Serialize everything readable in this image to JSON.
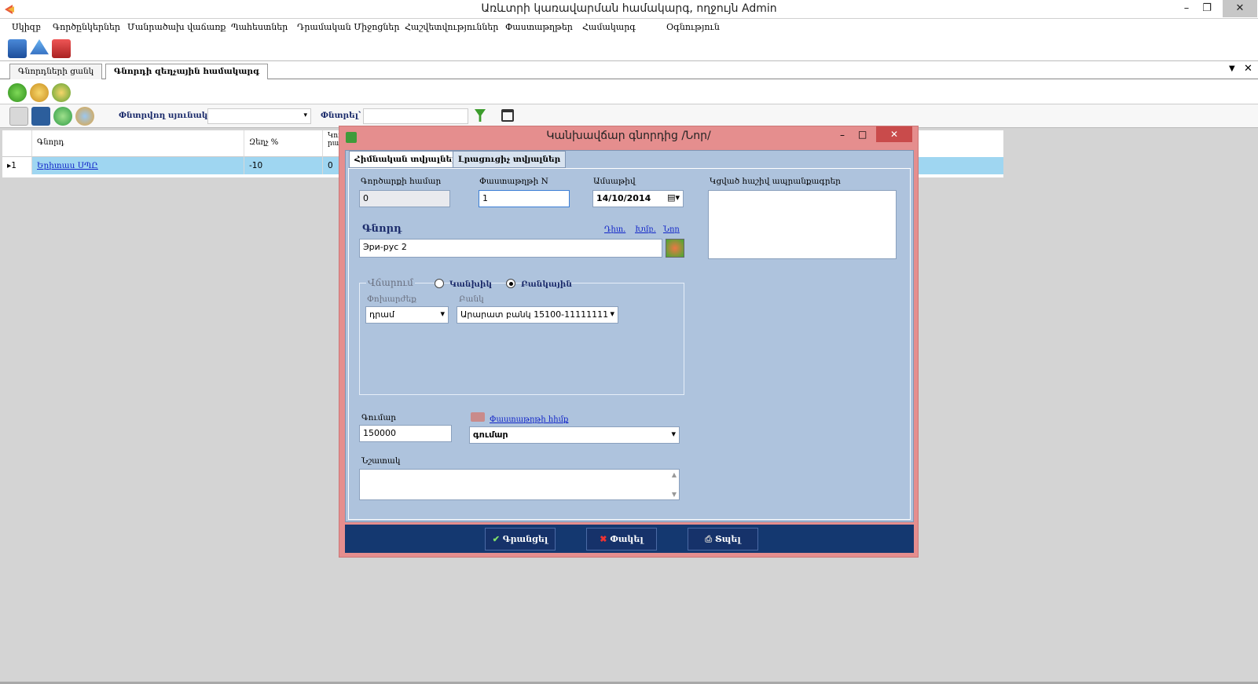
{
  "window": {
    "title": "Առևտրի կառավարման համակարգ, ողջույն Admin",
    "min": "–",
    "restore": "❐",
    "close": "✕"
  },
  "menu": [
    "Սկիզբ",
    "Գործընկերներ",
    "Մանրածախ վաճառք",
    "Պահեստներ",
    "Դրամական Միջոցներ",
    "Հաշվետվություններ",
    "Փաստաթղթեր",
    "Համակարգ",
    "Օգնություն"
  ],
  "tabs": [
    "Գնորդների ցանկ",
    "Գնորդի զեղչային համակարգ"
  ],
  "toolbar": {
    "search_column_label": "Փնտրվող սյունակ՝",
    "search_label": "Փնտրել՝"
  },
  "grid": {
    "headers": [
      "Գնորդ",
      "Զեղչ %",
      "Կու րա"
    ],
    "row": {
      "marker": "▸1",
      "buyer": "Երիտաս ՍՊԸ",
      "discount": "-10",
      "third": "0"
    }
  },
  "dialog": {
    "title": "Կանխավճար գնորդից /Նոր/",
    "tabs": [
      "Հիմնական տվյալներ",
      "Լրացուցիչ տվյալներ"
    ],
    "op_number_label": "Գործարքի համար",
    "op_number_value": "0",
    "doc_number_label": "Փաստաթղթի N",
    "doc_number_value": "1",
    "date_label": "Ամսաթիվ",
    "date_value": "14/10/2014",
    "notes_label": "Կցված հաշիվ ապրանքագրեր",
    "buyer_label": "Գնորդ",
    "buyer_links": [
      "Դիտ.",
      "Խմբ.",
      "Նոր"
    ],
    "buyer_value": "Эри-рус 2",
    "payment_label": "Վճարում",
    "radio_cash": "Կանխիկ",
    "radio_bank": "Բանկային",
    "currency_label": "Փոխարժեք",
    "currency_value": "դրամ",
    "bank_label": "Բանկ",
    "bank_value": "Արարատ բանկ 15100-11111111",
    "amount_label": "Գումար",
    "amount_value": "150000",
    "doc_basis_link": "Փաստաթղթի հիմք",
    "basis_value": "գումար",
    "comment_label": "Նշատակ",
    "buttons": {
      "save": "Գրանցել",
      "close": "Փակել",
      "print": "Տպել"
    }
  }
}
